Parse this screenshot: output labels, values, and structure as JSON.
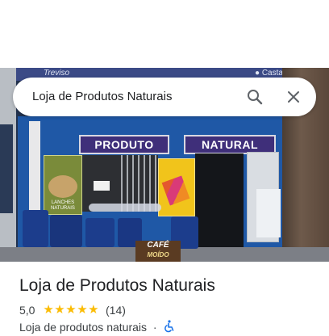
{
  "search": {
    "query": "Loja de Produtos Naturais"
  },
  "photo": {
    "banner_left": "Treviso",
    "banner_right": "● Castanhas",
    "sign_produto": "PRODUTO",
    "sign_natural": "NATURAL",
    "poster_left_text": "LANCHES NATURAIS",
    "cafe_board_top": "CAFÉ",
    "cafe_board_bottom": "MOÍDO"
  },
  "place": {
    "title": "Loja de Produtos Naturais",
    "rating": "5,0",
    "stars": "★★★★★",
    "review_count": "(14)",
    "category": "Loja de produtos naturais",
    "separator": "·"
  },
  "colors": {
    "star": "#fbbc04",
    "accessibility": "#1a73e8"
  }
}
